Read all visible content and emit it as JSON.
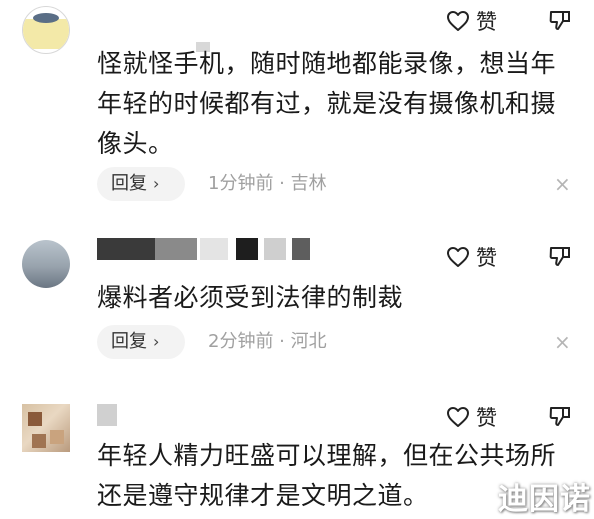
{
  "comments": [
    {
      "text": "怪就怪手机，随时随地都能录像，想当年年轻的时候都有过，就是没有摄像机和摄像头。",
      "like_label": "赞",
      "reply_label": "回复",
      "reply_chevron": "›",
      "meta": "1分钟前 · 吉林",
      "close_glyph": "×"
    },
    {
      "text": "爆料者必须受到法律的制裁",
      "like_label": "赞",
      "reply_label": "回复",
      "reply_chevron": "›",
      "meta": "2分钟前 · 河北",
      "close_glyph": "×"
    },
    {
      "text": "年轻人精力旺盛可以理解，但在公共场所还是遵守规律才是文明之道。",
      "like_label": "赞"
    }
  ],
  "watermark": "迪因诺",
  "icons": [
    "heart-icon",
    "dislike-icon",
    "chevron-right-icon",
    "close-icon"
  ],
  "colors": {
    "meta_text": "#a0a0a0",
    "pill_bg": "#f3f3f3",
    "primary_text": "#1a1a1a"
  }
}
